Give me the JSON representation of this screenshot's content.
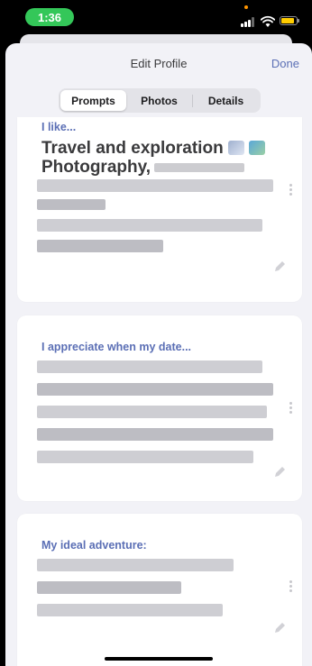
{
  "status": {
    "time": "1:36"
  },
  "nav": {
    "title": "Edit Profile",
    "done": "Done"
  },
  "tabs": [
    {
      "label": "Prompts",
      "active": true
    },
    {
      "label": "Photos",
      "active": false
    },
    {
      "label": "Details",
      "active": false
    }
  ],
  "cards": [
    {
      "question": "I like...",
      "answer_line1": "Travel and exploration",
      "answer_line2": "Photography,"
    },
    {
      "question": "I appreciate when my date..."
    },
    {
      "question": "My ideal adventure:"
    }
  ],
  "colors": {
    "accent": "#5b6fb5",
    "status_green": "#34c759",
    "background": "#f2f2f7"
  },
  "icons": [
    "signal-icon",
    "wifi-icon",
    "battery-icon",
    "more-dots-icon",
    "edit-pencil-icon",
    "airplane-emoji-icon",
    "map-emoji-icon"
  ]
}
